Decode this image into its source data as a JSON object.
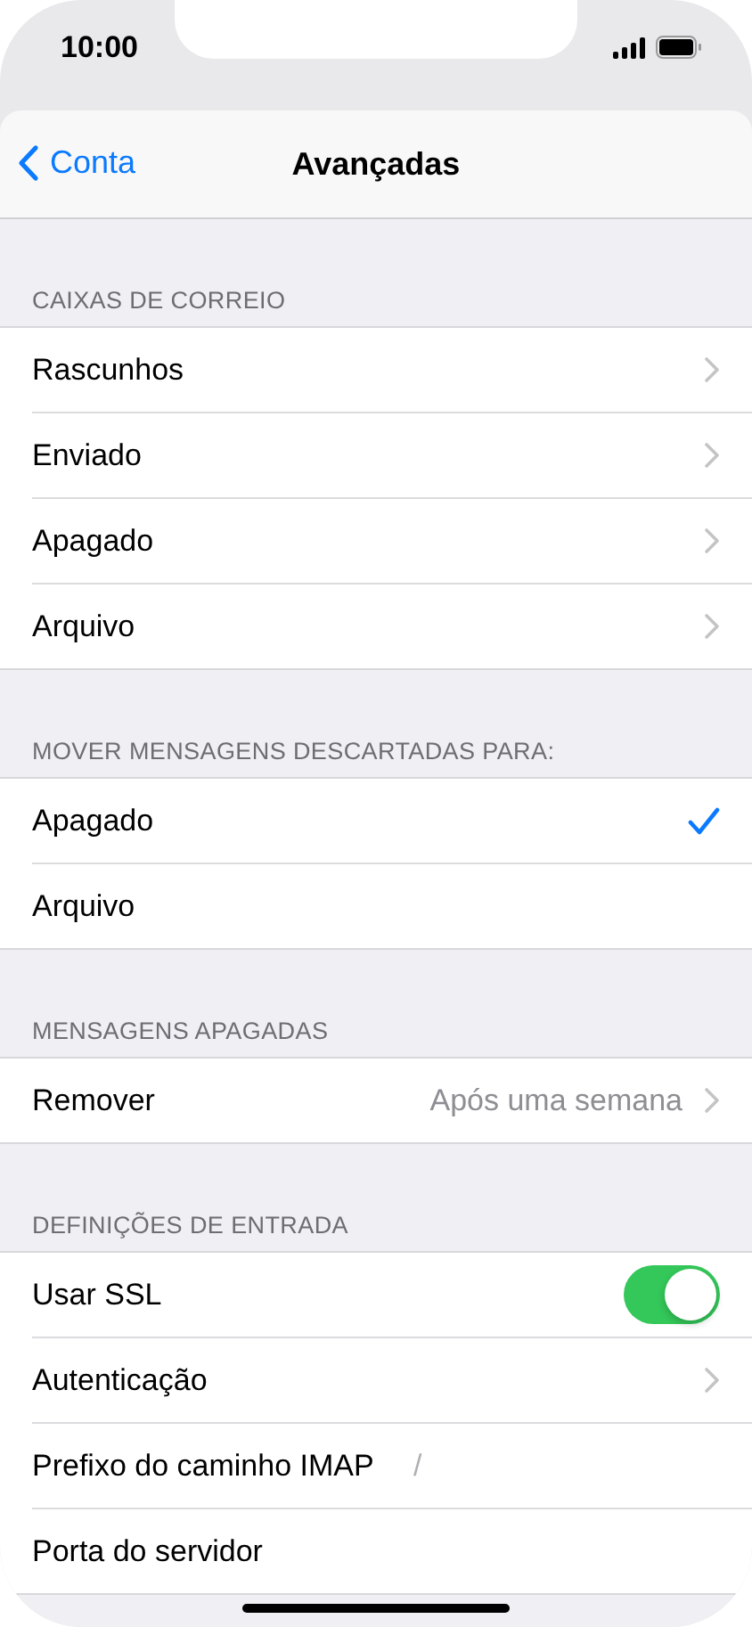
{
  "status_bar": {
    "time": "10:00"
  },
  "nav": {
    "back": "Conta",
    "title": "Avançadas"
  },
  "sections": [
    {
      "header": "CAIXAS DE CORREIO",
      "rows": [
        {
          "kind": "chevron",
          "label": "Rascunhos"
        },
        {
          "kind": "chevron",
          "label": "Enviado"
        },
        {
          "kind": "chevron",
          "label": "Apagado"
        },
        {
          "kind": "chevron",
          "label": "Arquivo"
        }
      ]
    },
    {
      "header": "MOVER MENSAGENS DESCARTADAS PARA:",
      "rows": [
        {
          "kind": "check",
          "label": "Apagado",
          "selected": true
        },
        {
          "kind": "check",
          "label": "Arquivo",
          "selected": false
        }
      ]
    },
    {
      "header": "MENSAGENS APAGADAS",
      "rows": [
        {
          "kind": "value",
          "label": "Remover",
          "value": "Após uma semana"
        }
      ]
    },
    {
      "header": "DEFINIÇÕES DE ENTRADA",
      "rows": [
        {
          "kind": "toggle",
          "label": "Usar SSL",
          "on": true
        },
        {
          "kind": "chevron",
          "label": "Autenticação"
        },
        {
          "kind": "field",
          "label": "Prefixo do caminho IMAP",
          "value": "/"
        },
        {
          "kind": "field",
          "label": "Porta do servidor"
        }
      ]
    }
  ]
}
